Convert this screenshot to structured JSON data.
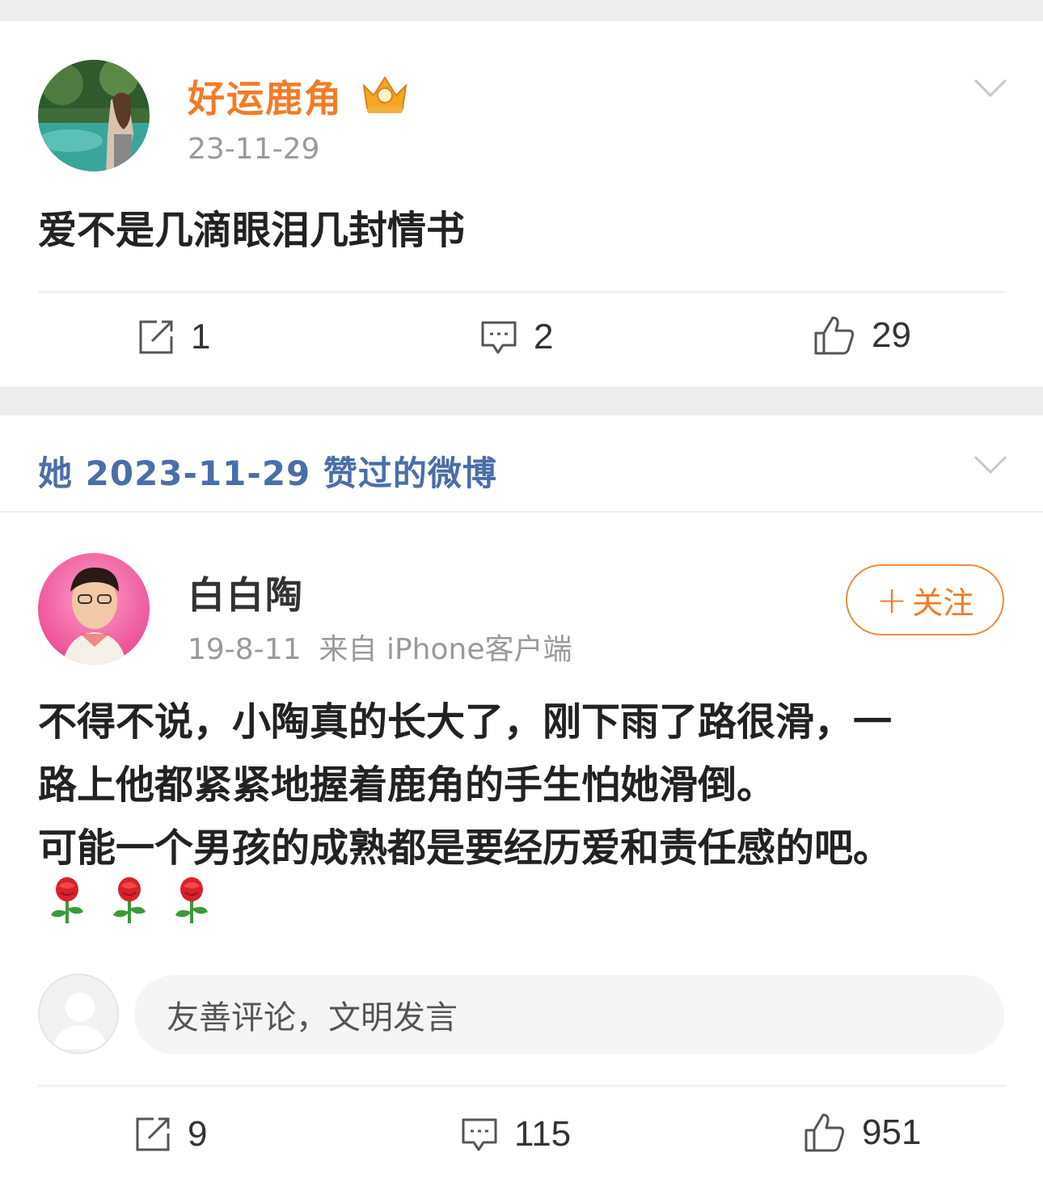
{
  "post1": {
    "username": "好运鹿角",
    "date": "23-11-29",
    "text": "爱不是几滴眼泪几封情书",
    "actions": {
      "repost_count": "1",
      "comment_count": "2",
      "like_count": "29"
    }
  },
  "liked_section": {
    "title": "她 2023-11-29 赞过的微博"
  },
  "post2": {
    "username": "白白陶",
    "date": "19-8-11",
    "source": "来自 iPhone客户端",
    "follow_label": "关注",
    "follow_plus": "+",
    "text_line1": "不得不说，小陶真的长大了，刚下雨了路很滑，一",
    "text_line2": "路上他都紧紧地握着鹿角的手生怕她滑倒。",
    "text_line3": "可能一个男孩的成熟都是要经历爱和责任感的吧。",
    "comment_placeholder": "友善评论，文明发言",
    "actions": {
      "repost_count": "9",
      "comment_count": "115",
      "like_count": "951"
    }
  },
  "colors": {
    "accent_orange": "#f27c25",
    "link_blue": "#4a6ea8",
    "gray_text": "#9a9a9a"
  },
  "icons": [
    "crown-icon",
    "chevron-down-icon",
    "repost-icon",
    "comment-icon",
    "like-icon",
    "rose-icon"
  ]
}
